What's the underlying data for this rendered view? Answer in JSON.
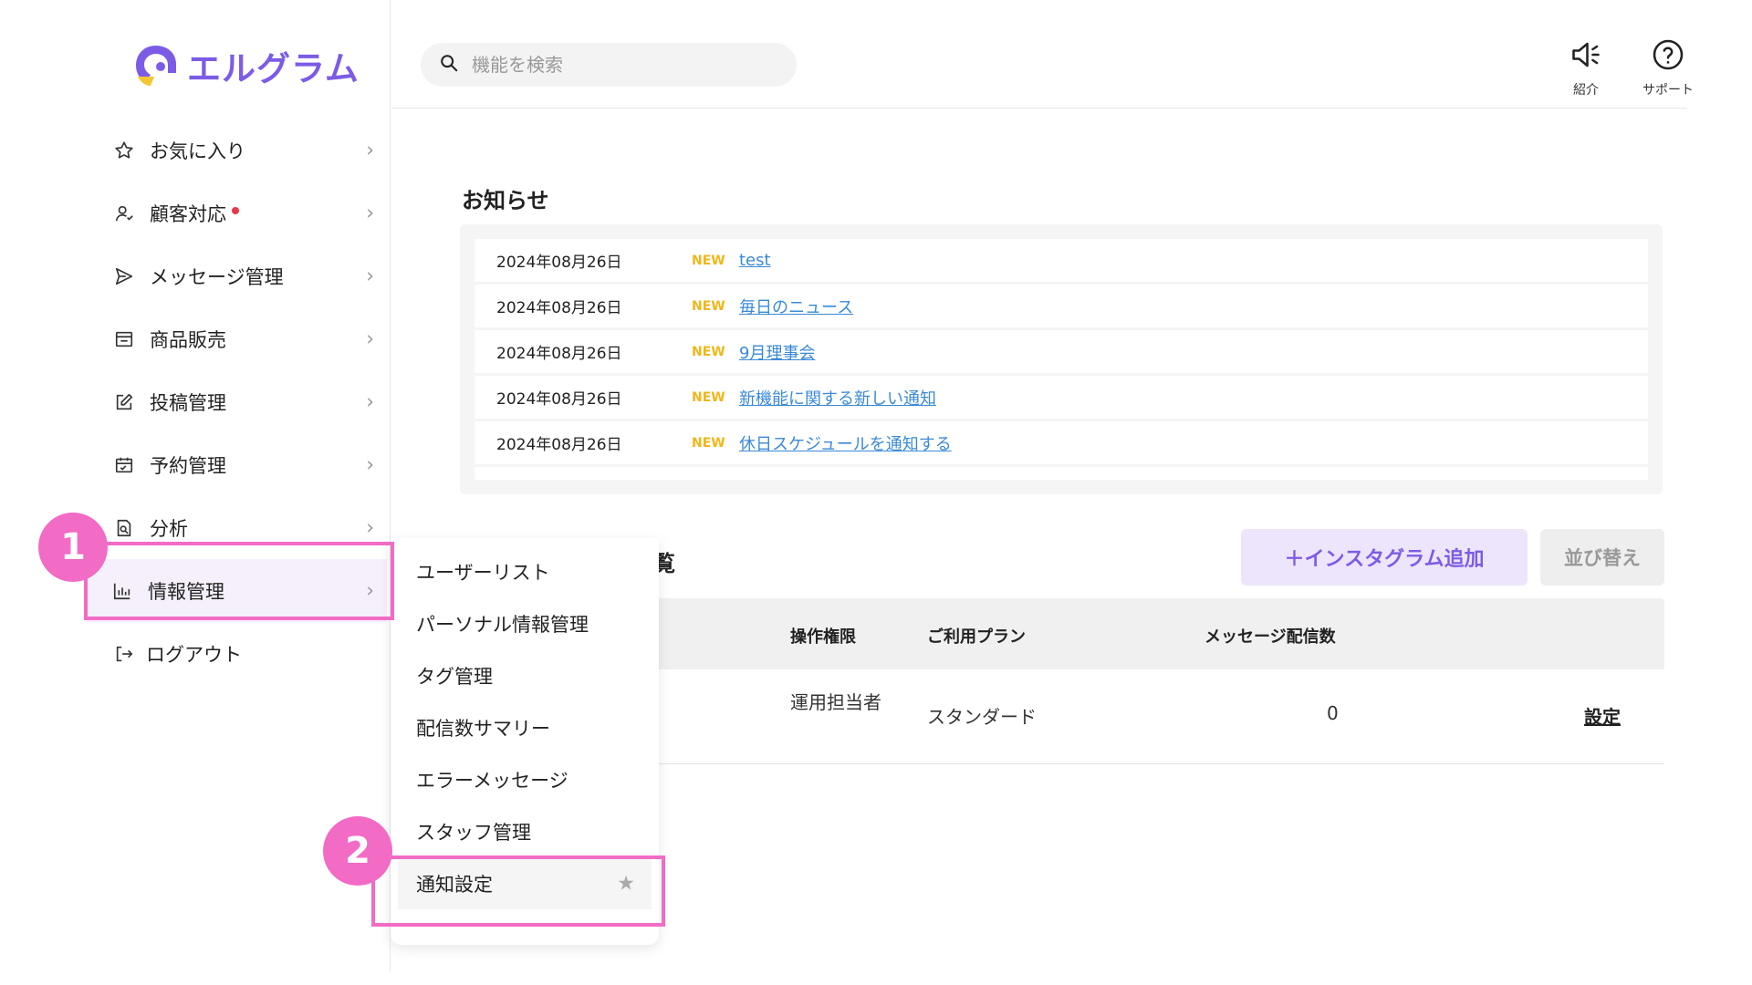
{
  "logo": {
    "text": "エルグラム"
  },
  "sidebar": {
    "items": [
      {
        "label": "お気に入り",
        "icon": "star-icon"
      },
      {
        "label": "顧客対応",
        "icon": "user-icon",
        "dot": true
      },
      {
        "label": "メッセージ管理",
        "icon": "send-icon"
      },
      {
        "label": "商品販売",
        "icon": "store-icon"
      },
      {
        "label": "投稿管理",
        "icon": "edit-icon"
      },
      {
        "label": "予約管理",
        "icon": "calendar-icon"
      },
      {
        "label": "分析",
        "icon": "report-icon"
      },
      {
        "label": "情報管理",
        "icon": "bar-chart-icon",
        "active": true
      },
      {
        "label": "ログアウト",
        "icon": "logout-icon"
      }
    ]
  },
  "search": {
    "placeholder": "機能を検索"
  },
  "header": {
    "intro_label": "紹介",
    "support_label": "サポート"
  },
  "notices": {
    "title": "お知らせ",
    "new_label": "NEW",
    "items": [
      {
        "date": "2024年08月26日",
        "title": "test"
      },
      {
        "date": "2024年08月26日",
        "title": "毎日のニュース"
      },
      {
        "date": "2024年08月26日",
        "title": "9月理事会"
      },
      {
        "date": "2024年08月26日",
        "title": "新機能に関する新しい通知"
      },
      {
        "date": "2024年08月26日",
        "title": "休日スケジュールを通知する"
      }
    ]
  },
  "accounts": {
    "title_fragment": "覧",
    "add_button": "＋インスタグラム追加",
    "sort_button": "並び替え",
    "columns": [
      "操作権限",
      "ご利用プラン",
      "メッセージ配信数"
    ],
    "row": {
      "permission": "運用担当者",
      "plan": "スタンダード",
      "count": "0",
      "setting": "設定"
    }
  },
  "submenu": {
    "items": [
      "ユーザーリスト",
      "パーソナル情報管理",
      "タグ管理",
      "配信数サマリー",
      "エラーメッセージ",
      "スタッフ管理",
      "通知設定"
    ]
  },
  "annotations": {
    "badge1": "1",
    "badge2": "2",
    "color": "#f26bc5"
  },
  "colors": {
    "accent": "#7c5ce6",
    "link": "#3a8ad6",
    "new": "#f2b619",
    "alert_dot": "#e8364a"
  }
}
